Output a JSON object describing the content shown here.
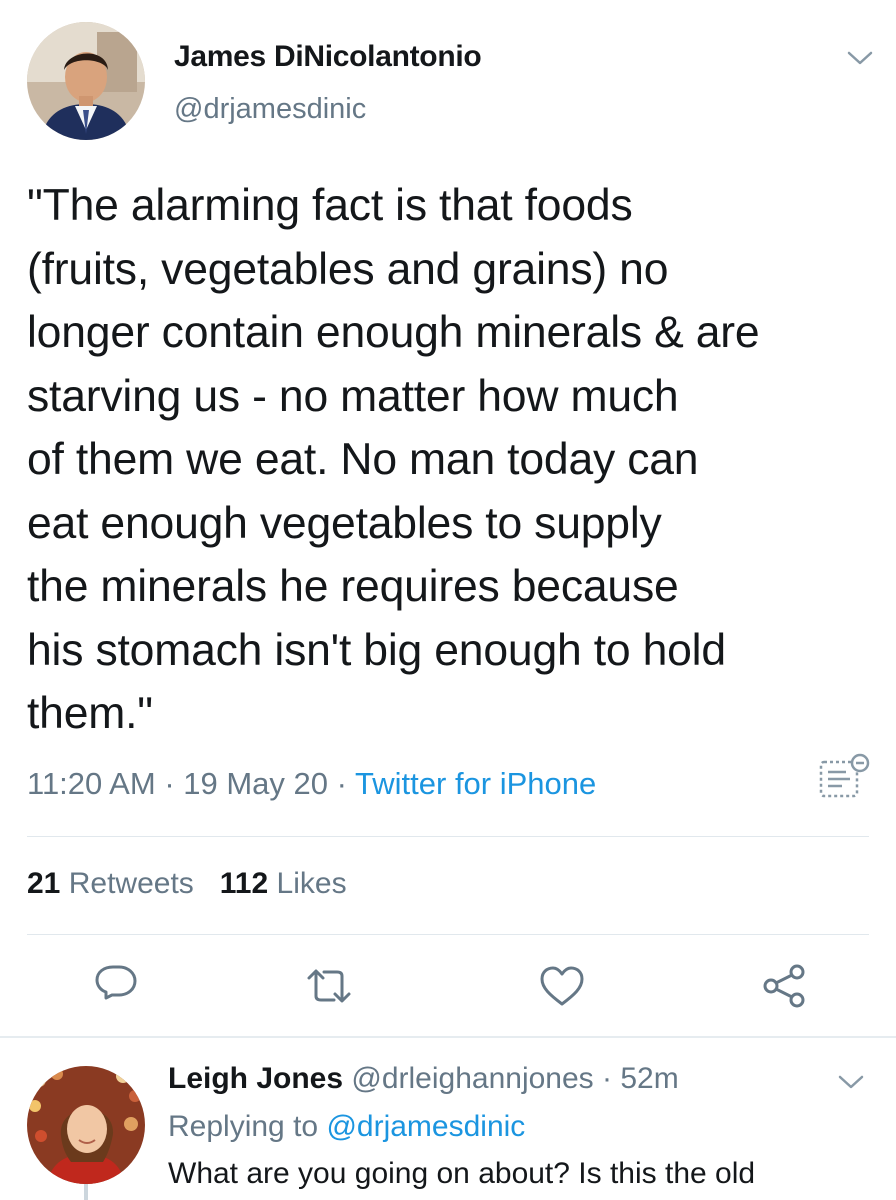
{
  "tweet": {
    "author_name": "James DiNicolantonio",
    "author_handle": "@drjamesdinic",
    "text_lines": [
      "\"The alarming fact is that foods",
      "(fruits, vegetables and grains) no",
      "longer contain enough minerals & are",
      "starving us - no matter how much",
      "of them we eat. No man today can",
      "eat enough vegetables to supply",
      "the minerals he requires because",
      "his stomach isn't big enough to hold",
      "them.\""
    ],
    "time": "11:20 AM",
    "date": "19 May 20",
    "separator": "·",
    "source": "Twitter for iPhone",
    "retweet_count": "21",
    "retweet_label": "Retweets",
    "like_count": "112",
    "like_label": "Likes"
  },
  "actions": {
    "reply_icon": "reply-icon",
    "retweet_icon": "retweet-icon",
    "like_icon": "heart-icon",
    "share_icon": "share-icon"
  },
  "reply": {
    "author_name": "Leigh Jones",
    "author_handle": "@drleighannjones",
    "separator": "·",
    "time": "52m",
    "replying_prefix": "Replying to",
    "replying_to": "@drjamesdinic",
    "text": "What are you going on about? Is this the old"
  },
  "colors": {
    "text": "#14171a",
    "secondary": "#657786",
    "accent": "#1b95e0",
    "divider": "#e1e8ed"
  }
}
